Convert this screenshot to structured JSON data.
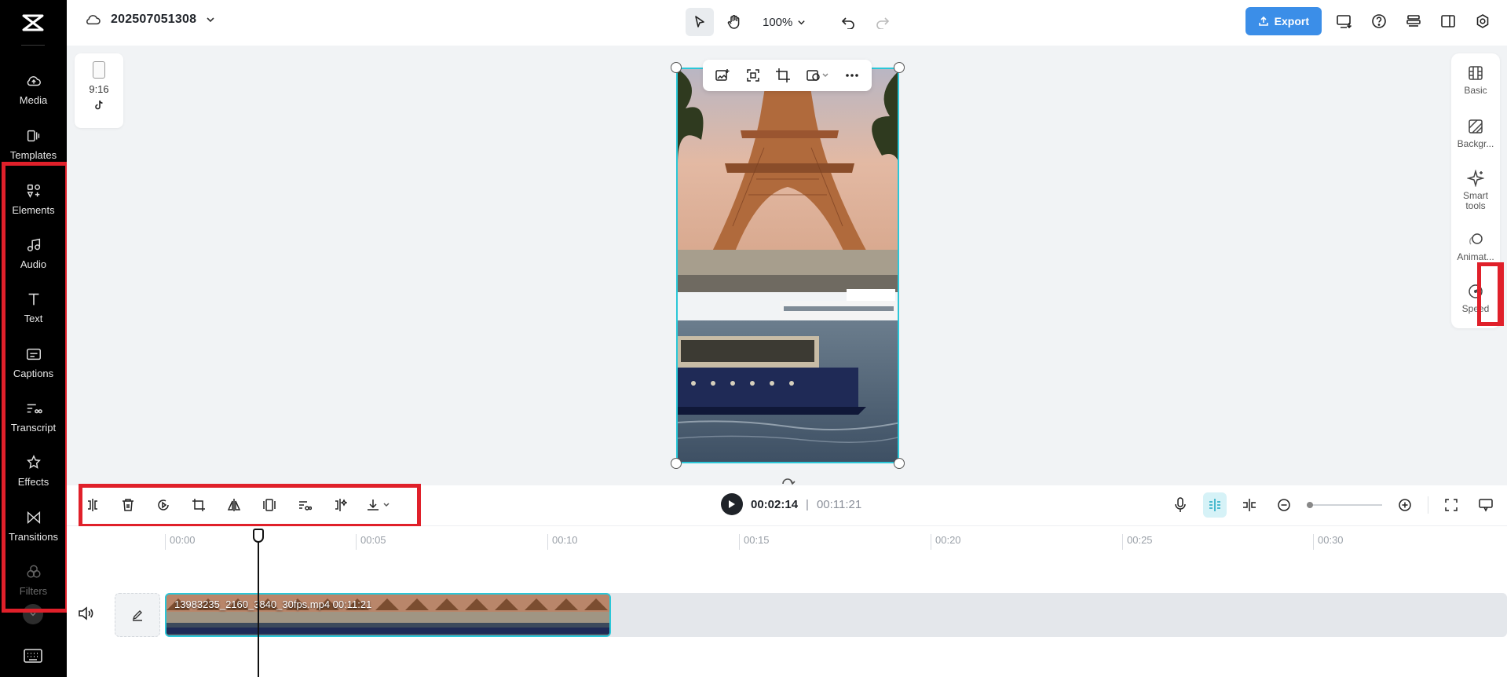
{
  "project": {
    "title": "202507051308"
  },
  "sidebar": {
    "items": [
      {
        "label": "Media",
        "icon": "cloud-upload-icon"
      },
      {
        "label": "Templates",
        "icon": "templates-icon"
      },
      {
        "label": "Elements",
        "icon": "elements-icon"
      },
      {
        "label": "Audio",
        "icon": "music-note-icon"
      },
      {
        "label": "Text",
        "icon": "text-icon"
      },
      {
        "label": "Captions",
        "icon": "captions-icon"
      },
      {
        "label": "Transcript",
        "icon": "transcript-icon"
      },
      {
        "label": "Effects",
        "icon": "effects-icon"
      },
      {
        "label": "Transitions",
        "icon": "transitions-icon"
      },
      {
        "label": "Filters",
        "icon": "filters-icon"
      }
    ]
  },
  "topbar": {
    "zoom": "100%",
    "export_label": "Export"
  },
  "canvas": {
    "aspect_ratio": "9:16"
  },
  "right_panel": {
    "items": [
      {
        "label": "Basic",
        "icon": "basic-icon"
      },
      {
        "label": "Backgr...",
        "icon": "background-icon"
      },
      {
        "label": "Smart tools",
        "icon": "sparkle-icon"
      },
      {
        "label": "Animat...",
        "icon": "animation-icon"
      },
      {
        "label": "Speed",
        "icon": "speed-icon"
      }
    ]
  },
  "playback": {
    "current_time": "00:02:14",
    "separator": "|",
    "total_time": "00:11:21"
  },
  "timeline": {
    "ruler": [
      "00:00",
      "00:05",
      "00:10",
      "00:15",
      "00:20",
      "00:25",
      "00:30"
    ],
    "clip_label": "13983235_2160_3840_30fps.mp4   00:11:21"
  },
  "highlight_color": "#e0202a",
  "accent_color": "#2bc7d8",
  "export_color": "#3b8ee8"
}
